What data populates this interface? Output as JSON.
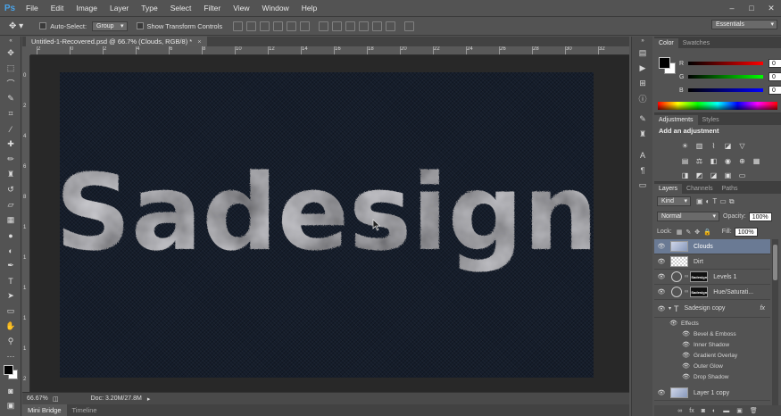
{
  "app": {
    "logo": "Ps"
  },
  "menu": [
    "File",
    "Edit",
    "Image",
    "Layer",
    "Type",
    "Select",
    "Filter",
    "View",
    "Window",
    "Help"
  ],
  "window_controls": {
    "minimize": "–",
    "maximize": "□",
    "close": "✕"
  },
  "options_bar": {
    "auto_select_label": "Auto-Select:",
    "auto_select_value": "Group",
    "show_transform_label": "Show Transform Controls",
    "workspace": "Essentials"
  },
  "document": {
    "tab_title": "Untitled-1-Recovered.psd @ 66.7% (Clouds, RGB/8) *",
    "close": "×",
    "art_text": "Sadesign"
  },
  "ruler": {
    "top": [
      "2",
      "0",
      "2",
      "4",
      "6",
      "8",
      "10",
      "12",
      "14",
      "16",
      "18",
      "20",
      "22",
      "24",
      "26",
      "28",
      "30",
      "32"
    ],
    "left": [
      "0",
      "2",
      "4",
      "6",
      "8",
      "1",
      "1",
      "1",
      "1",
      "1",
      "2"
    ]
  },
  "status": {
    "zoom": "66.67%",
    "doc_info": "Doc: 3.20M/27.8M",
    "arrow": "▸"
  },
  "bottom_tabs": [
    "Mini Bridge",
    "Timeline"
  ],
  "color_panel": {
    "tabs": [
      "Color",
      "Swatches"
    ],
    "sliders": [
      {
        "label": "R",
        "value": "0",
        "color": "#ff2a2a"
      },
      {
        "label": "G",
        "value": "0",
        "color": "#2adf2a"
      },
      {
        "label": "B",
        "value": "0",
        "color": "#2a4aff"
      }
    ]
  },
  "adjustments_panel": {
    "tabs": [
      "Adjustments",
      "Styles"
    ],
    "title": "Add an adjustment"
  },
  "layers_panel": {
    "tabs": [
      "Layers",
      "Channels",
      "Paths"
    ],
    "filter_label": "Kind",
    "blend_mode": "Normal",
    "opacity_label": "Opacity:",
    "opacity_value": "100%",
    "lock_label": "Lock:",
    "fill_label": "Fill:",
    "fill_value": "100%",
    "layers": [
      {
        "name": "Clouds",
        "thumb": "cloud",
        "selected": true
      },
      {
        "name": "Dirt",
        "thumb": "checker",
        "selected": false
      },
      {
        "name": "Levels 1",
        "thumb": "sad",
        "adjustment": true,
        "selected": false
      },
      {
        "name": "Hue/Saturati...",
        "thumb": "sad",
        "adjustment": true,
        "selected": false
      },
      {
        "name": "Sadesign copy",
        "thumb": "text",
        "fx": "fx",
        "selected": false
      }
    ],
    "effects_label": "Effects",
    "effects": [
      "Bevel & Emboss",
      "Inner Shadow",
      "Gradient Overlay",
      "Outer Glow",
      "Drop Shadow"
    ],
    "last_layer": "Layer 1 copy",
    "thumb_text": "Sadesign"
  },
  "colors": {
    "canvas_bg": "#151d2b",
    "panel_bg": "#535353",
    "selection": "#6a7a94"
  }
}
